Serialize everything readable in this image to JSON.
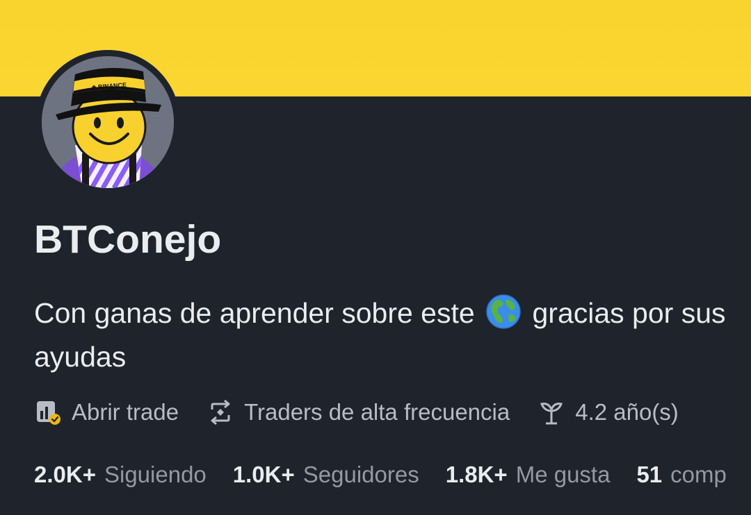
{
  "profile": {
    "username": "BTConejo",
    "bio_part1": "Con ganas de aprender sobre este",
    "bio_emoji": "globe-emoji",
    "bio_part2": "gracias por sus ayudas",
    "avatar_badge_text": "BINANCE"
  },
  "meta": [
    {
      "icon": "chart-check-icon",
      "label": "Abrir trade"
    },
    {
      "icon": "swap-arrows-icon",
      "label": "Traders de alta frecuencia"
    },
    {
      "icon": "sprout-icon",
      "label": "4.2 año(s)"
    }
  ],
  "stats": [
    {
      "value": "2.0K+",
      "label": "Siguiendo"
    },
    {
      "value": "1.0K+",
      "label": "Seguidores"
    },
    {
      "value": "1.8K+",
      "label": "Me gusta"
    },
    {
      "value": "51",
      "label": "comp"
    }
  ],
  "colors": {
    "banner": "#f9d42d",
    "background": "#1f232b",
    "text_primary": "#eaecef",
    "text_secondary": "#929aa5",
    "accent": "#f0b90b"
  }
}
